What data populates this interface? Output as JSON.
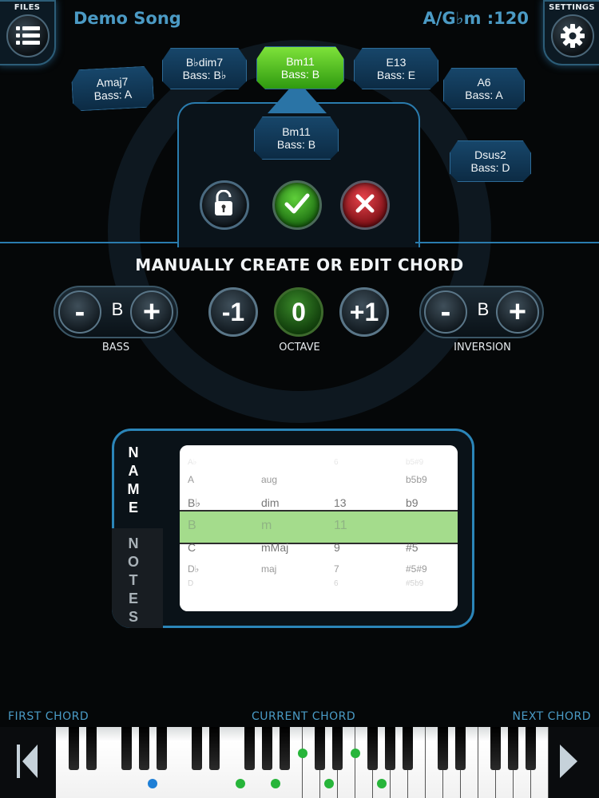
{
  "header": {
    "files_label": "FILES",
    "settings_label": "SETTINGS",
    "song_title": "Demo Song",
    "key_tempo": "A/G♭m :120"
  },
  "chord_wheel": {
    "chords": [
      {
        "name": "Amaj7",
        "bass": "Bass: A"
      },
      {
        "name": "B♭dim7",
        "bass": "Bass: B♭"
      },
      {
        "name": "Bm11",
        "bass": "Bass: B",
        "active": true
      },
      {
        "name": "E13",
        "bass": "Bass: E"
      },
      {
        "name": "A6",
        "bass": "Bass: A"
      },
      {
        "name": "Dsus2",
        "bass": "Bass: D"
      }
    ],
    "editing": {
      "name": "Bm11",
      "bass": "Bass: B"
    }
  },
  "actions": {
    "lock_icon": "unlock-icon",
    "confirm_icon": "check-icon",
    "cancel_icon": "x-icon"
  },
  "editor": {
    "title": "MANUALLY CREATE OR EDIT CHORD",
    "bass": {
      "label": "BASS",
      "minus": "-",
      "plus": "+",
      "value": "B"
    },
    "octave": {
      "label": "OCTAVE",
      "down": "-1",
      "current": "0",
      "up": "+1"
    },
    "inversion": {
      "label": "INVERSION",
      "minus": "-",
      "plus": "+",
      "value": "B"
    }
  },
  "picker": {
    "tab_name": [
      "N",
      "A",
      "M",
      "E"
    ],
    "tab_notes": [
      "N",
      "O",
      "T",
      "E",
      "S"
    ],
    "columns": [
      [
        "A♭",
        "A",
        "B♭",
        "B",
        "C",
        "D♭",
        "D"
      ],
      [
        "",
        "aug",
        "dim",
        "m",
        "mMaj",
        "maj",
        ""
      ],
      [
        "6",
        "",
        "13",
        "11",
        "9",
        "7",
        "6"
      ],
      [
        "b5#9",
        "b5b9",
        "b9",
        "",
        "#5",
        "#5#9",
        "#5b9"
      ]
    ],
    "selected_row_index": 3
  },
  "keyboard": {
    "first_chord_label": "FIRST  CHORD",
    "current_chord_label": "CURRENT  CHORD",
    "next_chord_label": "NEXT  CHORD"
  },
  "colors": {
    "accent_blue": "#4b9ac4",
    "chip_active_green": "#5ccc28",
    "highlight_green": "#a4dc8c",
    "note_green": "#27b53a",
    "note_blue": "#1e7fd6"
  }
}
